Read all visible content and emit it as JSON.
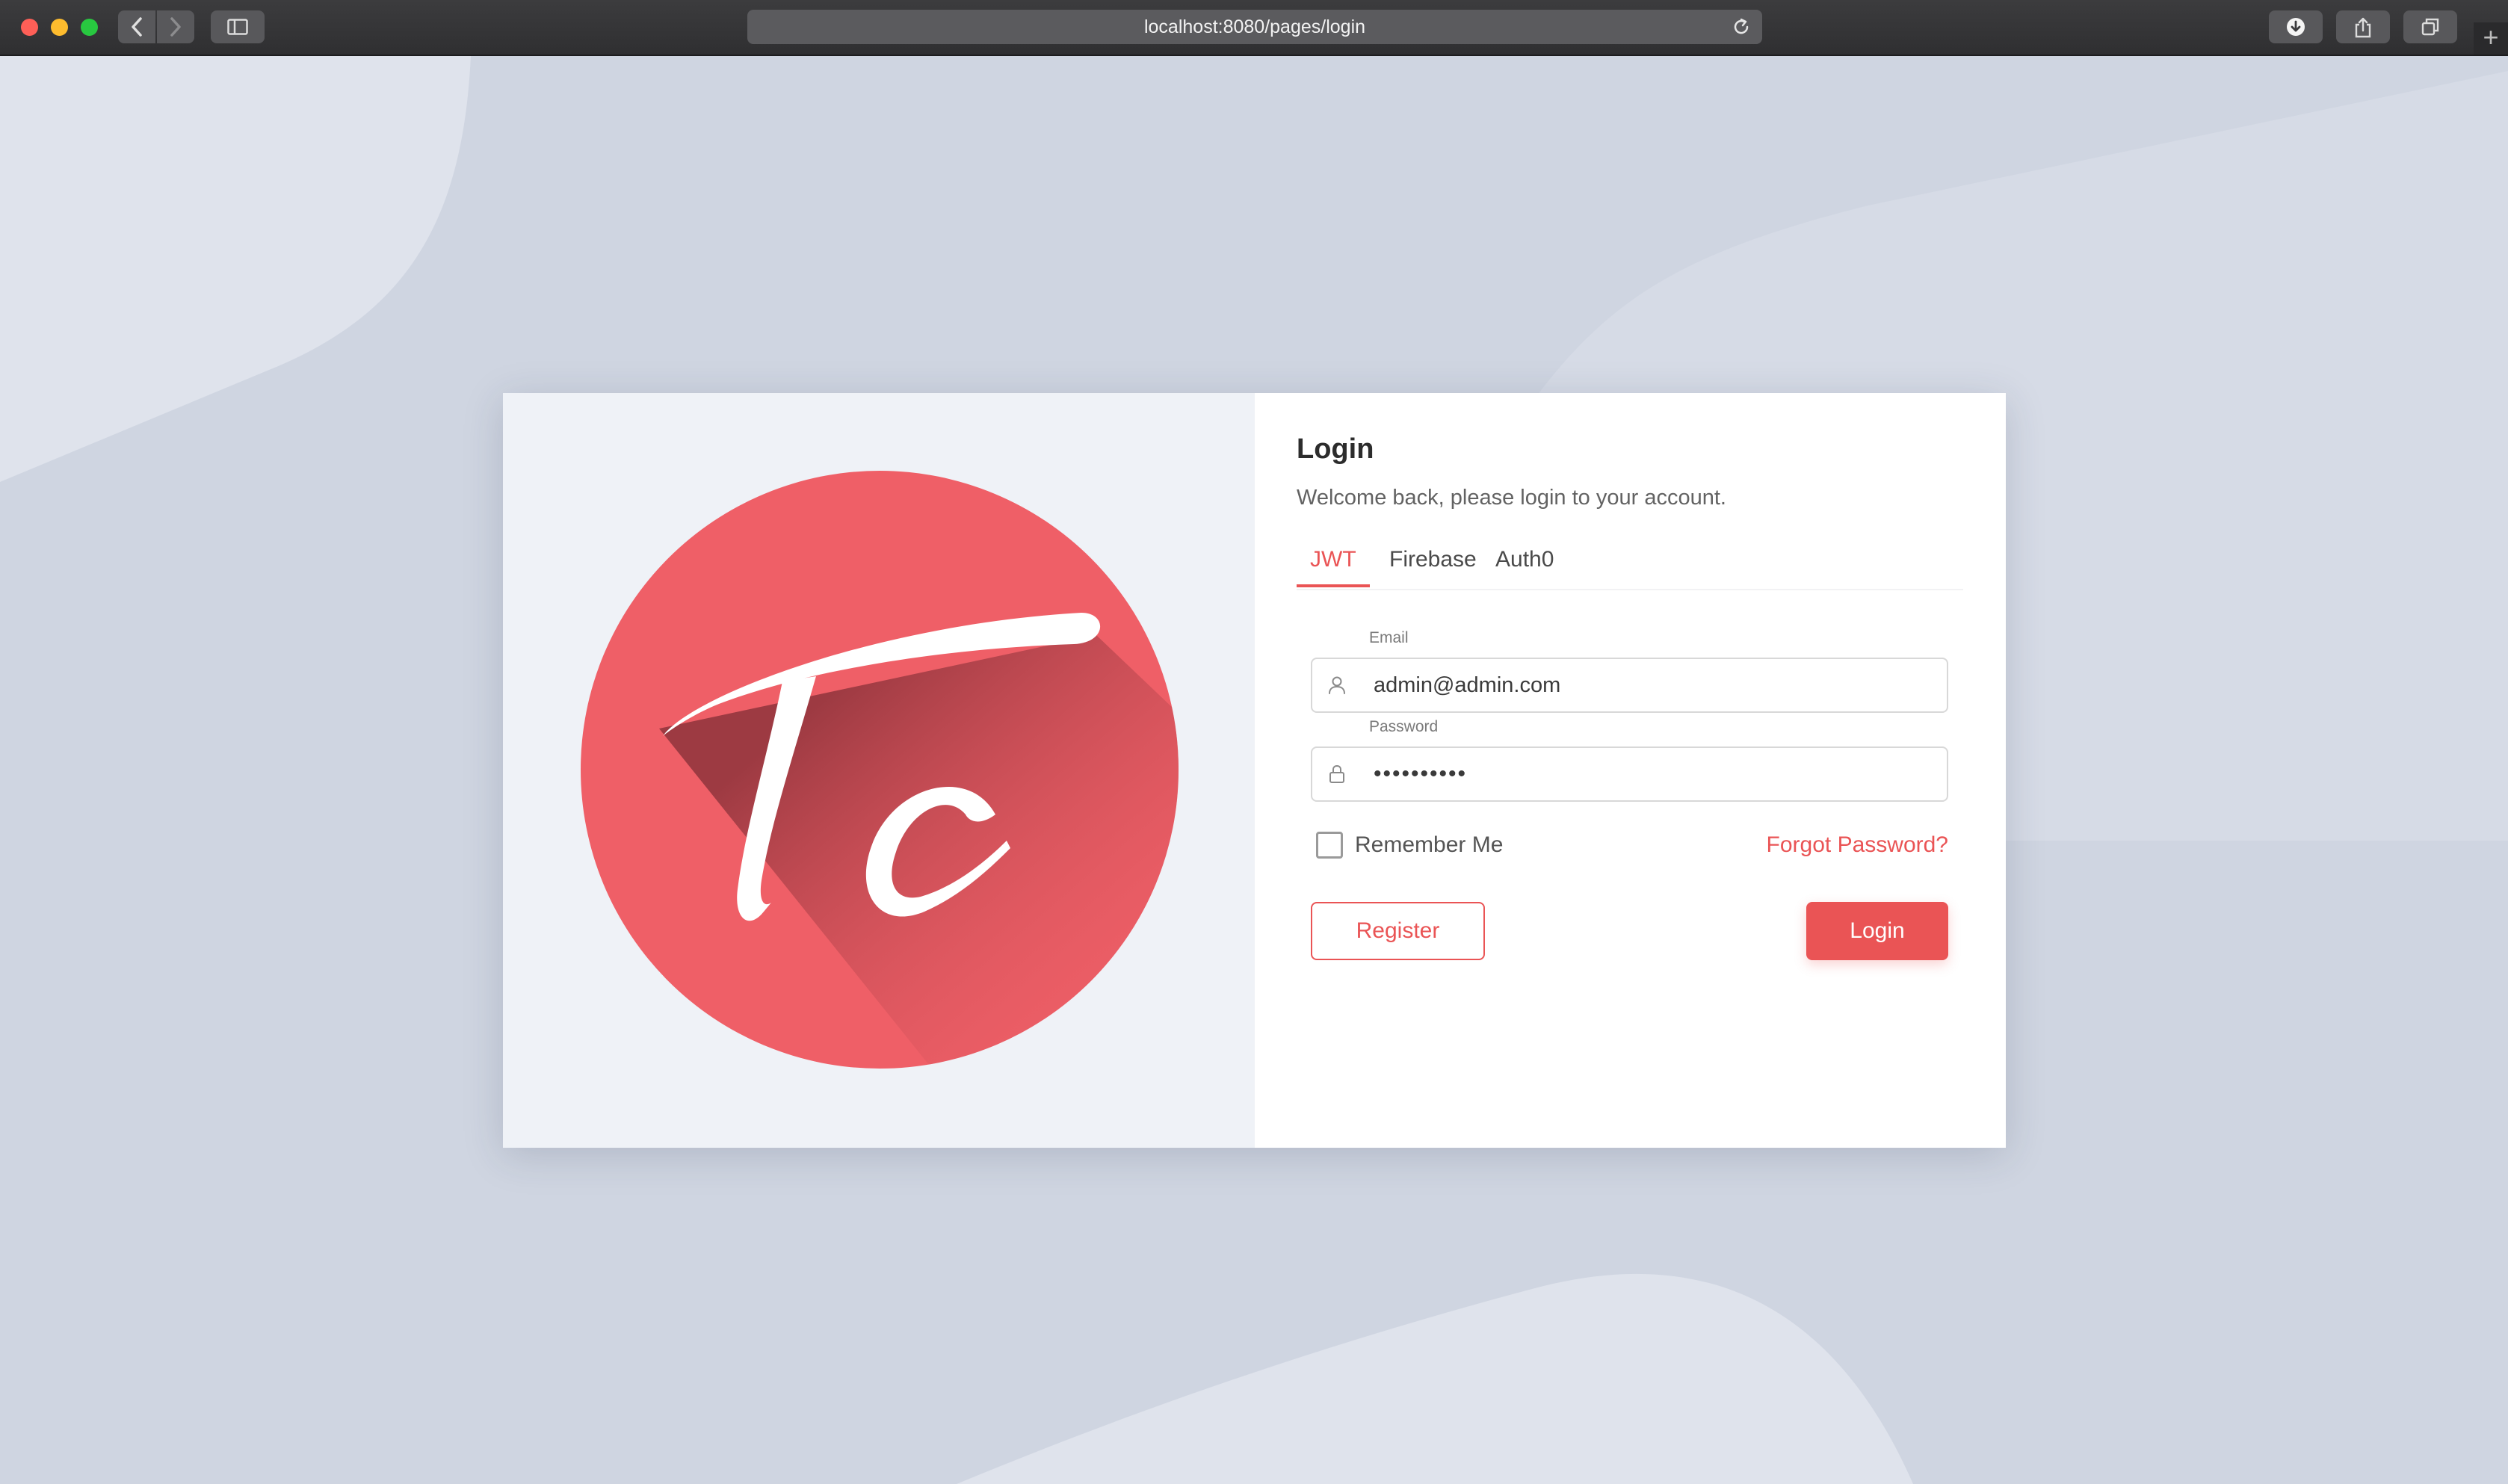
{
  "browser": {
    "url": "localhost:8080/pages/login",
    "icons": {
      "back": "chevron-left-icon",
      "forward": "chevron-right-icon",
      "sidebar": "sidebar-icon",
      "reload": "reload-icon",
      "download": "download-icon",
      "share": "share-icon",
      "tabs": "tabs-icon",
      "new_tab": "+"
    }
  },
  "login": {
    "title": "Login",
    "subtitle": "Welcome back, please login to your account.",
    "tabs": [
      {
        "label": "JWT",
        "active": true
      },
      {
        "label": "Firebase",
        "active": false
      },
      {
        "label": "Auth0",
        "active": false
      }
    ],
    "email": {
      "label": "Email",
      "value": "admin@admin.com"
    },
    "password": {
      "label": "Password",
      "value": "••••••••••"
    },
    "remember_label": "Remember Me",
    "remember_checked": false,
    "forgot_label": "Forgot Password?",
    "register_label": "Register",
    "login_label": "Login"
  },
  "colors": {
    "primary": "#ea5455",
    "logo": "#ef5f67",
    "page_background": "#cfd5e1",
    "card_left": "#eff2f7"
  }
}
